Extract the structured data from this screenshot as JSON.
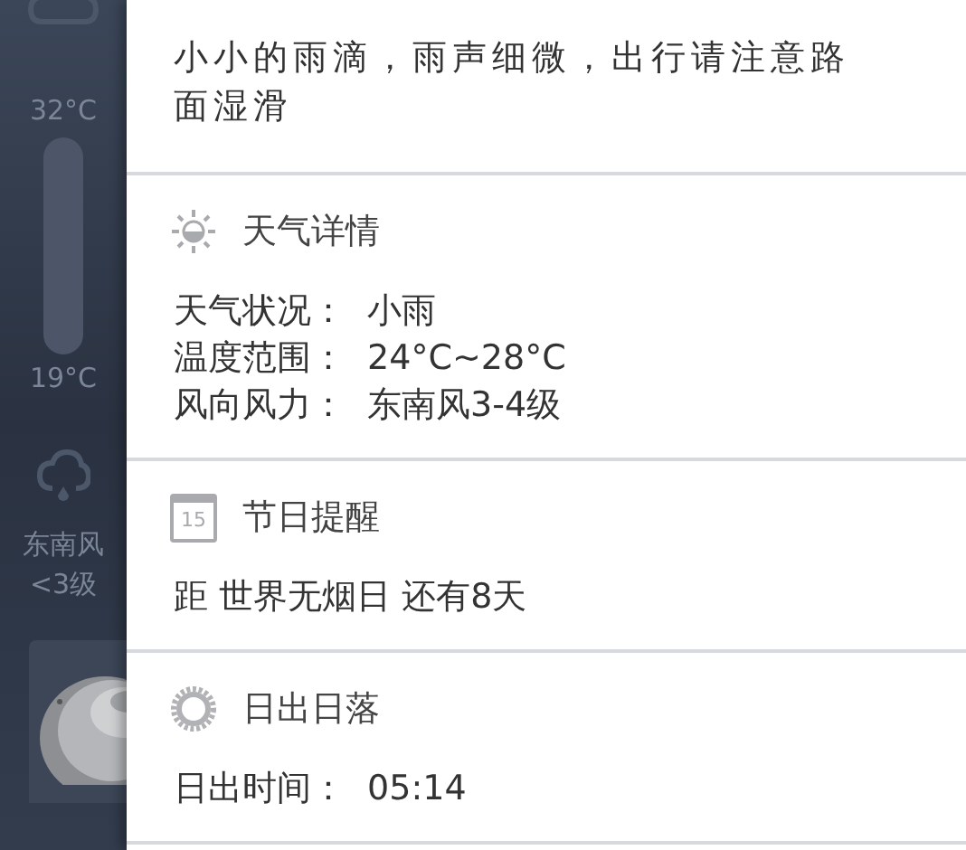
{
  "sidebar": {
    "temp_high": "32°C",
    "temp_low": "19°C",
    "wind": [
      "东南风",
      "<3级"
    ]
  },
  "summary": "小小的雨滴，雨声细微，出行请注意路面湿滑",
  "sections": [
    {
      "kind": "weather",
      "title": "天气详情",
      "rows": [
        {
          "label": "天气状况：",
          "value": "小雨"
        },
        {
          "label": "温度范围：",
          "value": "24°C~28°C"
        },
        {
          "label": "风向风力：",
          "value": "东南风3-4级"
        }
      ]
    },
    {
      "kind": "calendar",
      "title": "节日提醒",
      "icon_text": "15",
      "rows": [
        {
          "value": "距 世界无烟日 还有8天"
        }
      ]
    },
    {
      "kind": "sunrise",
      "title": "日出日落",
      "rows": [
        {
          "label": "日出时间：",
          "value": "05:14"
        }
      ]
    }
  ]
}
